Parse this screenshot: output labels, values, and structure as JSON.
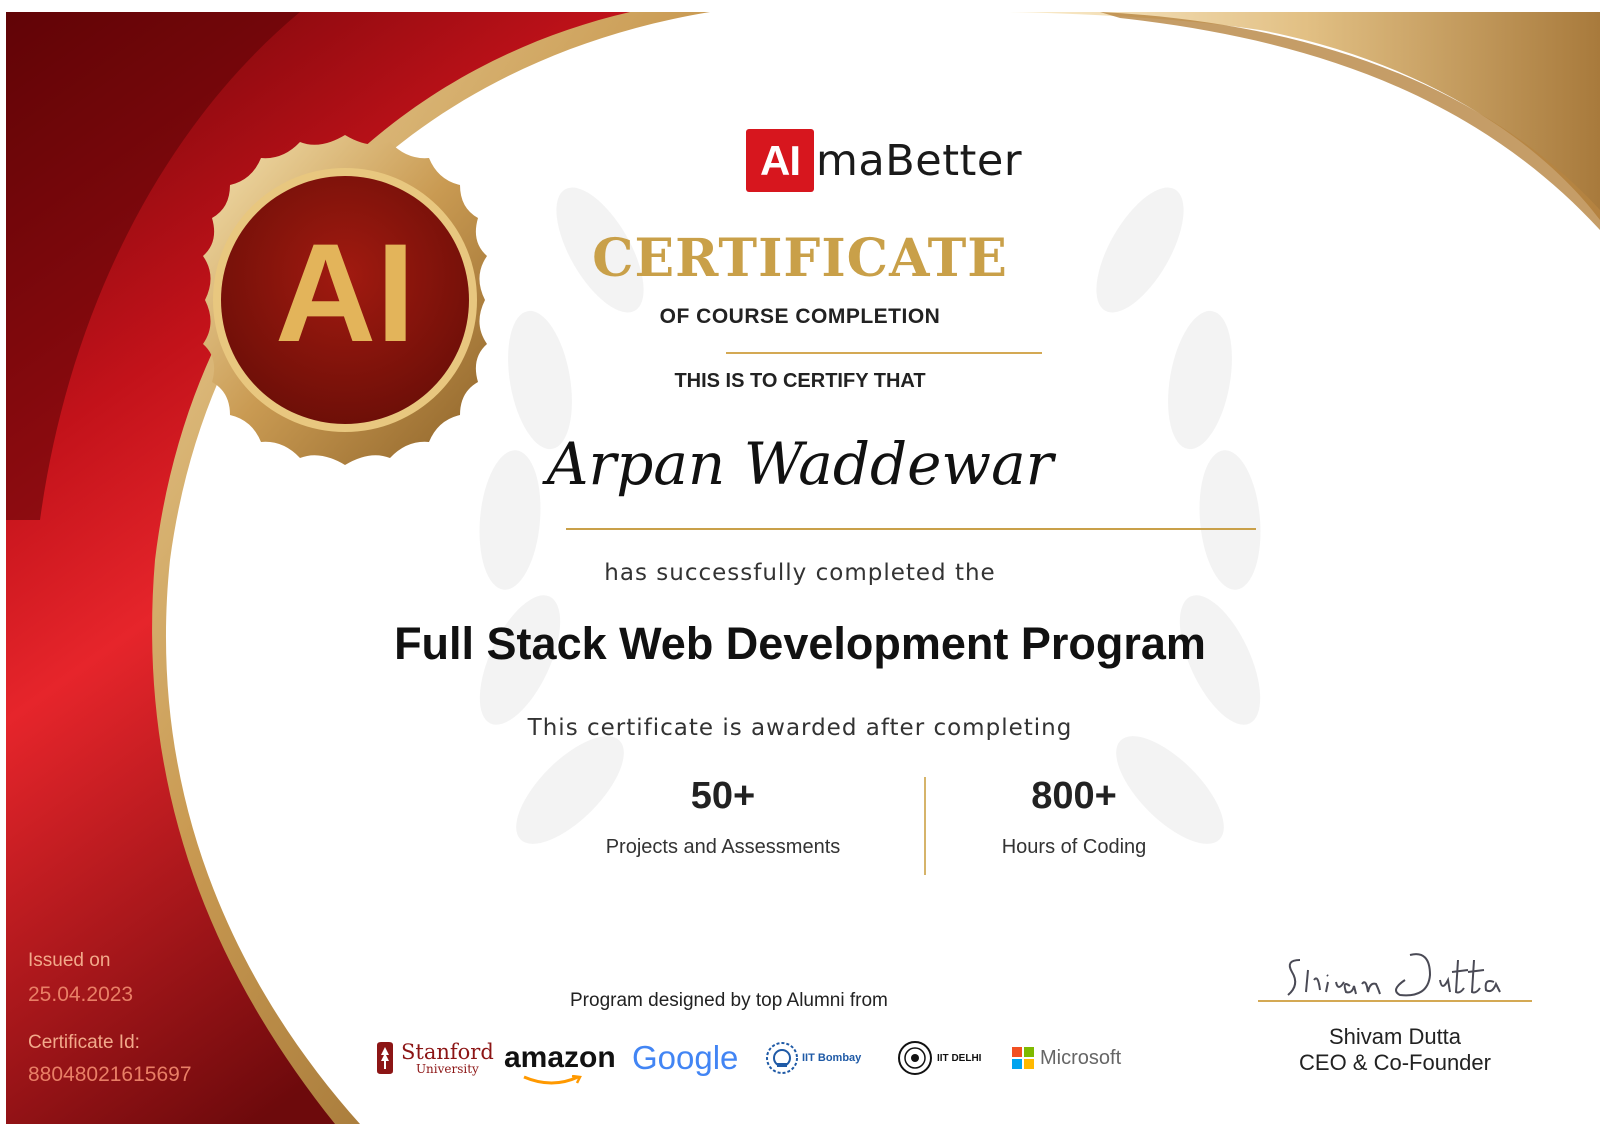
{
  "brand": {
    "logo_box": "AI",
    "logo_rest": "maBetter",
    "seal_text": "AI"
  },
  "certificate": {
    "title": "CERTIFICATE",
    "subtitle": "OF COURSE COMPLETION",
    "intro": "THIS IS TO CERTIFY THAT",
    "recipient": "Arpan Waddewar",
    "completed_text": "has successfully completed the",
    "program": "Full Stack Web Development Program",
    "awarded_text": "This certificate is awarded after completing"
  },
  "stats": [
    {
      "value": "50+",
      "label": "Projects and Assessments"
    },
    {
      "value": "800+",
      "label": "Hours of Coding"
    }
  ],
  "issue": {
    "issued_label": "Issued on",
    "issued_date": "25.04.2023",
    "cert_id_label": "Certificate Id:",
    "cert_id": "88048021615697"
  },
  "alumni": {
    "text": "Program designed by top Alumni from",
    "logos": {
      "stanford_name": "Stanford",
      "stanford_sub": "University",
      "amazon": "amazon",
      "google": "Google",
      "iit_bombay": "IIT Bombay",
      "iit_delhi": "IIT DELHI",
      "microsoft": "Microsoft"
    }
  },
  "signature": {
    "signed_as": "Shivam Dutta",
    "name": "Shivam Dutta",
    "title": "CEO & Co-Founder"
  },
  "colors": {
    "red": "#d7161e",
    "dark_red": "#6b0508",
    "gold": "#c9a049",
    "gold_line": "#d4a954"
  }
}
